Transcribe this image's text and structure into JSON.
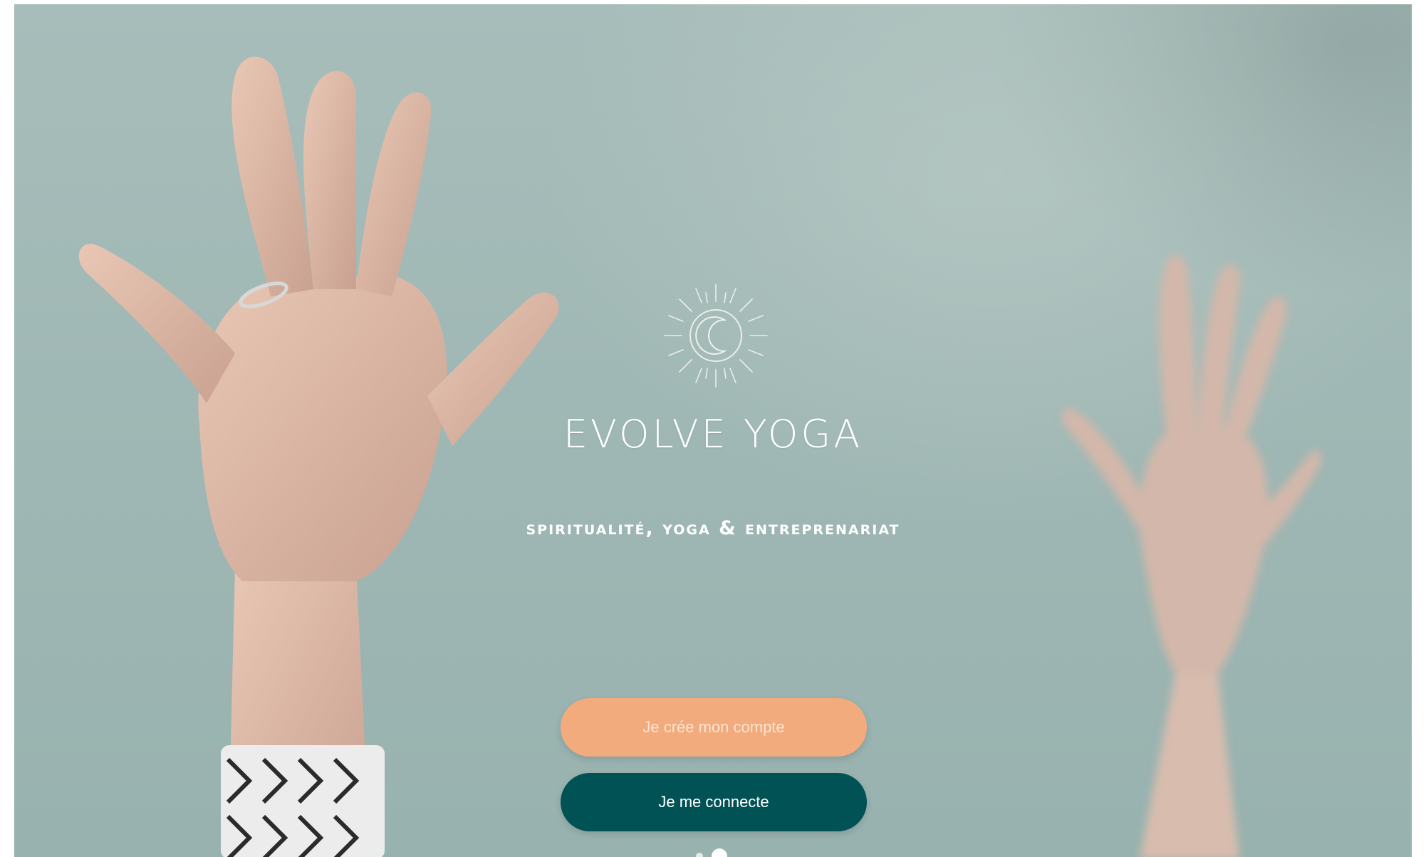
{
  "brand": {
    "title": "EVOLVE YOGA",
    "tagline": "SPIRITUALITÉ, YOGA & ENTREPRENARIAT",
    "logo_icon": "sun-moon-icon"
  },
  "buttons": {
    "create_account": "Je crée mon compte",
    "login": "Je me connecte"
  },
  "colors": {
    "create_button": "#f2ab7c",
    "login_button": "#005254",
    "background": "#a0b8b5"
  },
  "pager": {
    "pages": 2,
    "active_index": 1
  }
}
